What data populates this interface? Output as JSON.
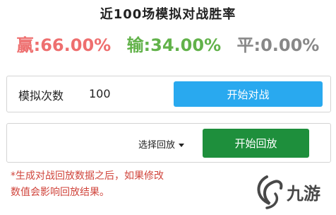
{
  "title": "近100场模拟对战胜率",
  "rates": {
    "win_label": "赢:66.00%",
    "lose_label": "输:34.00%",
    "draw_label": "平:0.00%"
  },
  "simulation": {
    "label": "模拟次数",
    "count_value": "100",
    "start_button": "开始对战"
  },
  "replay": {
    "select_label": "选择回放",
    "select_icon": "caret-down-icon",
    "start_button": "开始回放"
  },
  "note": {
    "line1": "*生成对战回放数据之后，如果修改",
    "line2": "数值会影响回放结果。"
  },
  "watermark": {
    "text": "九游"
  },
  "colors": {
    "win": "#ee6f6f",
    "lose": "#62b24a",
    "draw": "#888888",
    "start_battle_button": "#29a9ef",
    "start_replay_button": "#1e8f3c",
    "note": "#d0453c"
  }
}
